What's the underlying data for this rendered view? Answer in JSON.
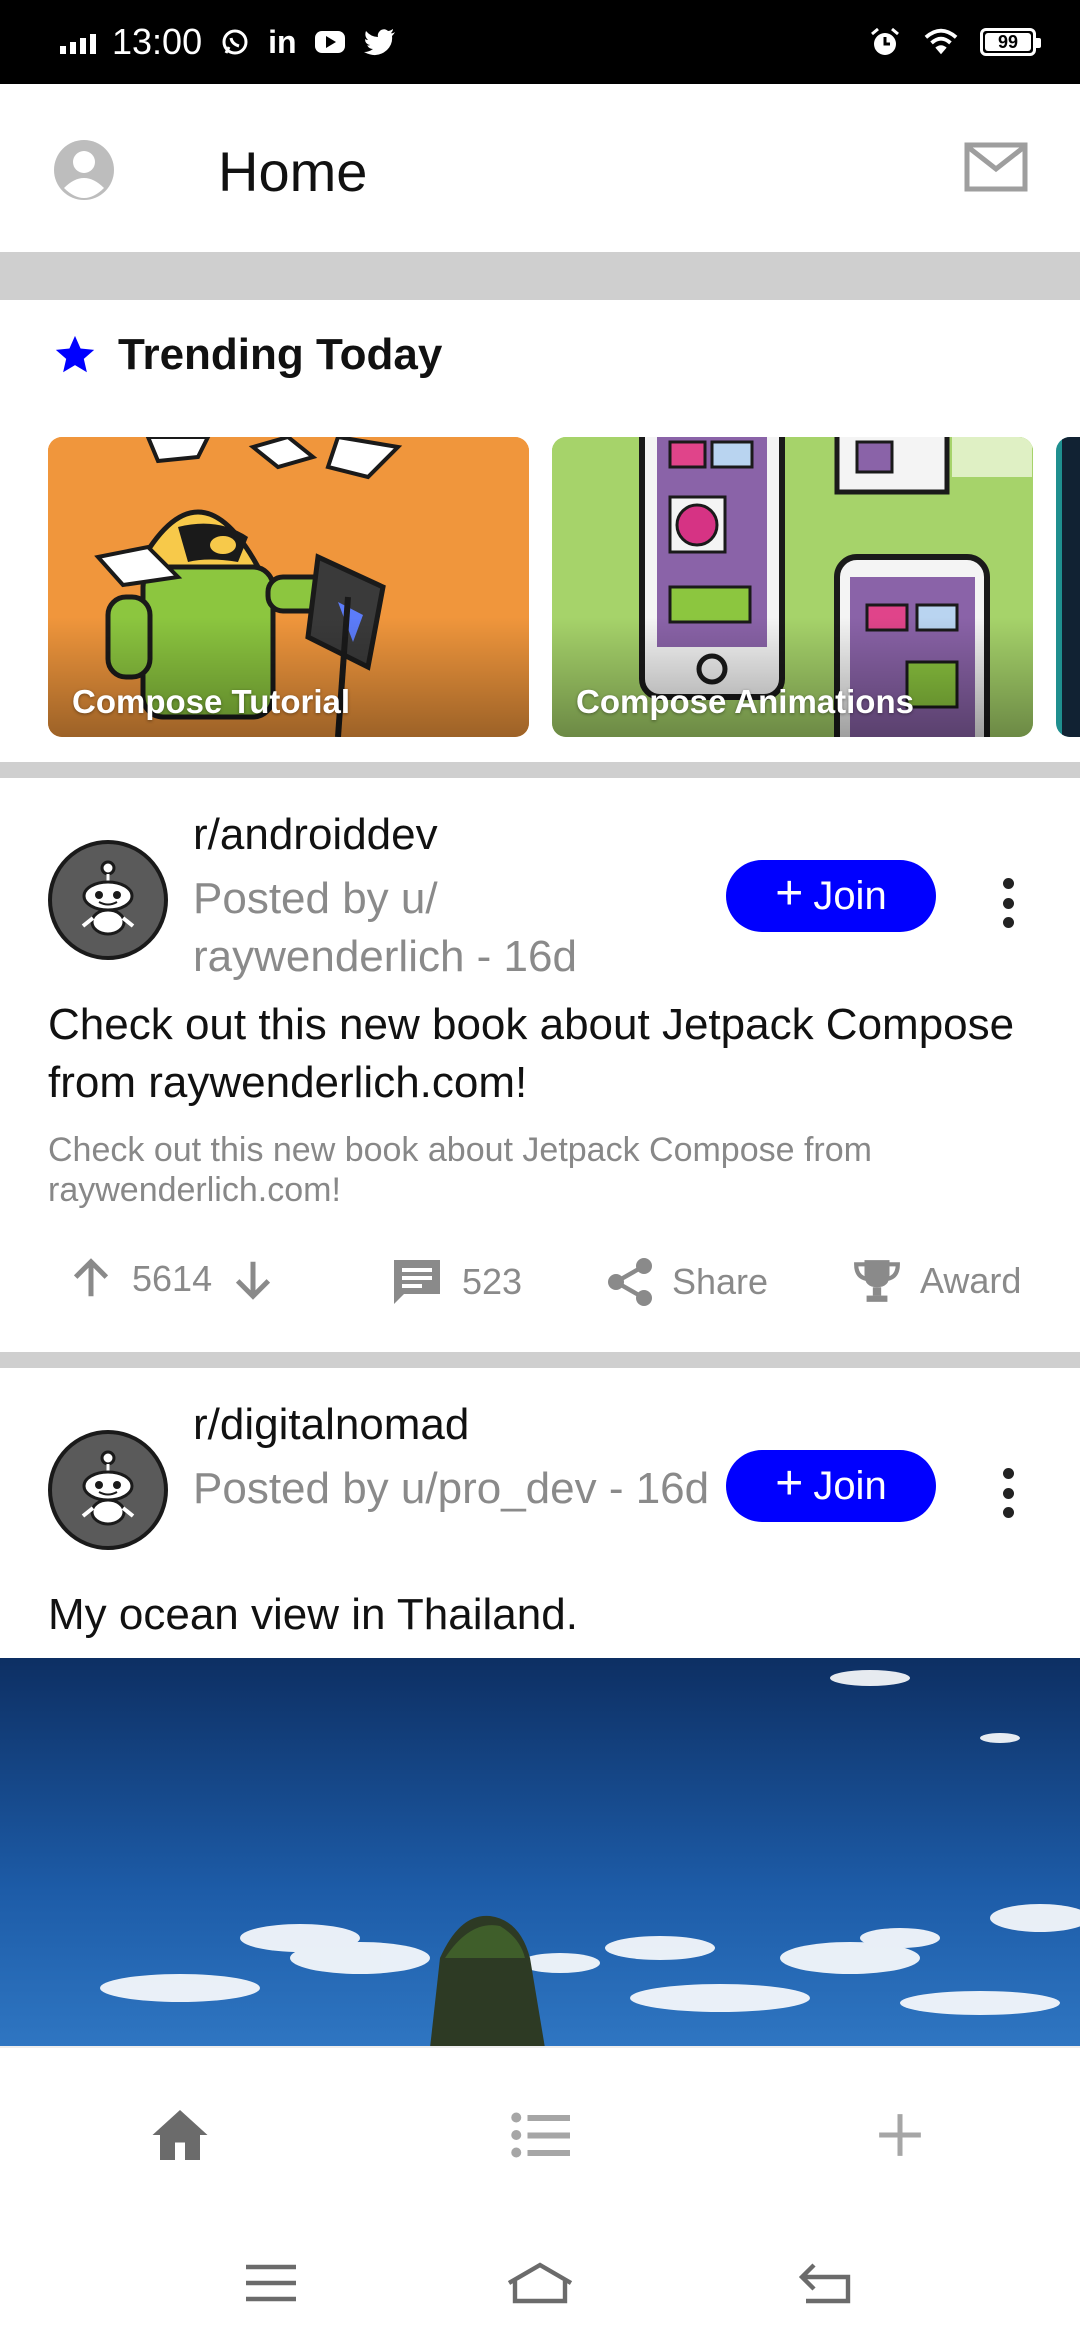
{
  "status_bar": {
    "time": "13:00",
    "battery": "99",
    "notification_icons": [
      "whatsapp-icon",
      "linkedin-icon",
      "youtube-icon",
      "twitter-icon"
    ],
    "system_icons": [
      "alarm-icon",
      "wifi-icon",
      "battery-icon"
    ]
  },
  "app_bar": {
    "title": "Home",
    "left_icon": "account-circle-icon",
    "right_icon": "mail-icon"
  },
  "trending": {
    "title": "Trending Today",
    "icon": "star-icon",
    "star_color": "#0000ff",
    "cards": [
      {
        "label": "Compose Tutorial",
        "background": "#f0963c"
      },
      {
        "label": "Compose Animations",
        "background": "#a6d36a"
      }
    ]
  },
  "posts": [
    {
      "subreddit": "r/androiddev",
      "posted_by": "Posted by u/ raywenderlich - 16d",
      "join_label": "Join",
      "title": "Check out this new book about Jetpack Compose from raywenderlich.com!",
      "body": "Check out this new book about Jetpack Compose from raywenderlich.com!",
      "votes": "5614",
      "comments": "523",
      "share_label": "Share",
      "award_label": "Award"
    },
    {
      "subreddit": "r/digitalnomad",
      "posted_by": "Posted by u/pro_dev - 16d",
      "join_label": "Join",
      "title": "My ocean view in Thailand."
    }
  ],
  "colors": {
    "accent": "#0000ff",
    "divider": "#cfcfcf",
    "secondary_text": "#8a8a8a"
  },
  "bottom_nav": {
    "items": [
      "home-icon",
      "list-icon",
      "add-icon"
    ]
  },
  "system_nav": {
    "items": [
      "menu-icon",
      "home-outline-icon",
      "back-icon"
    ]
  }
}
